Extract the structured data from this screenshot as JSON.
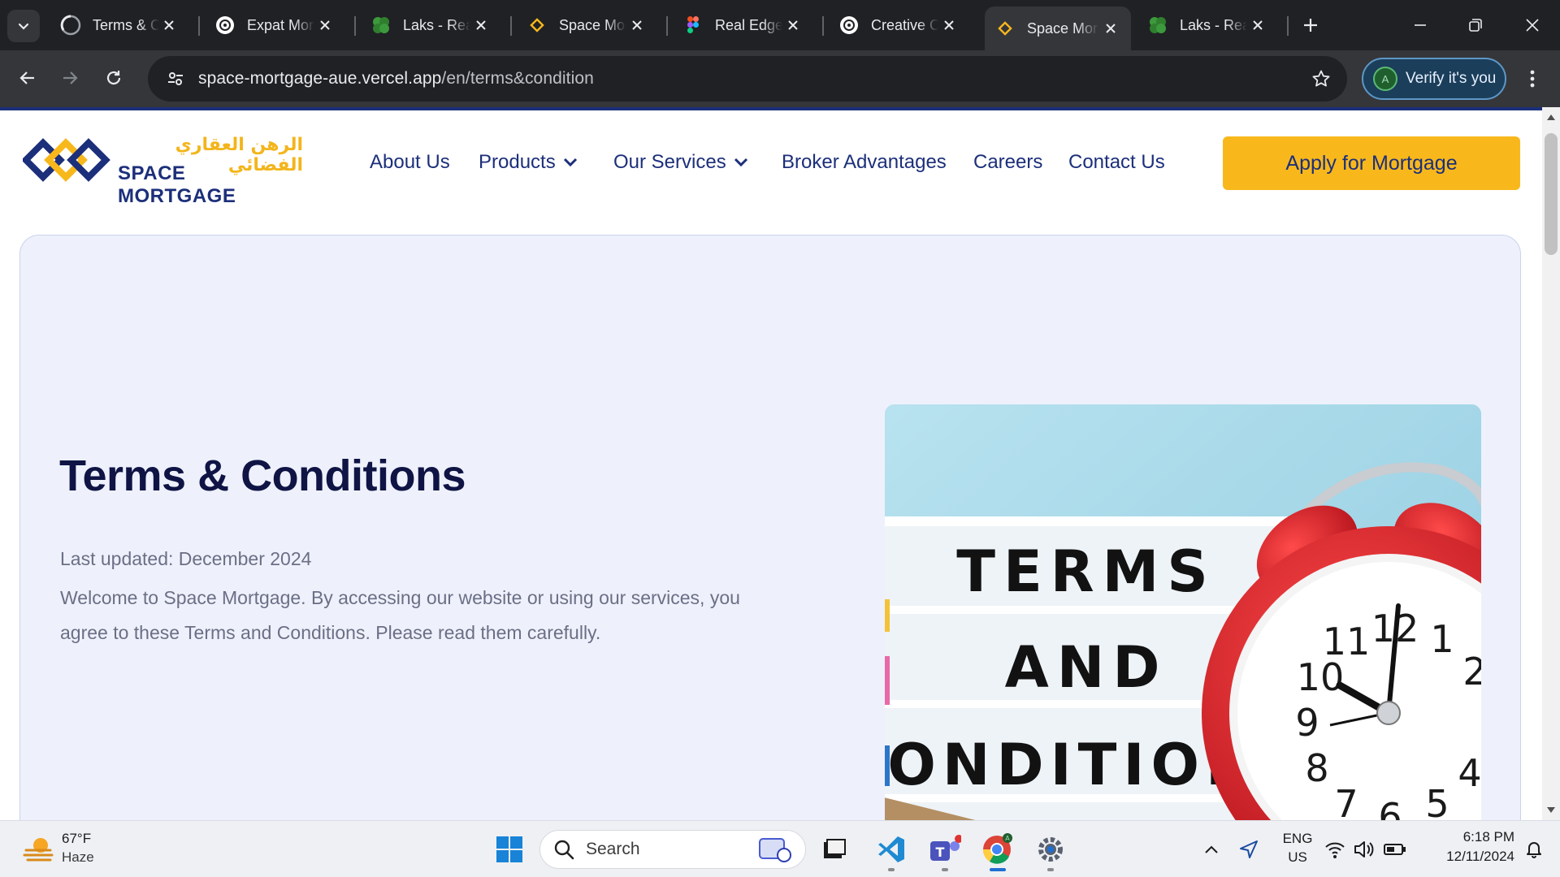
{
  "browser": {
    "tabs": [
      {
        "title": "Terms & Conditions",
        "favicon": "circle-loading-icon"
      },
      {
        "title": "Expat Mortgage",
        "favicon": "openai-icon"
      },
      {
        "title": "Laks - Real Estate",
        "favicon": "laks-clover-icon"
      },
      {
        "title": "Space Mortgage",
        "favicon": "space-mortgage-diamond-icon"
      },
      {
        "title": "Real Edge",
        "favicon": "figma-icon"
      },
      {
        "title": "Creative Content",
        "favicon": "openai-icon"
      },
      {
        "title": "Space Mortgage",
        "favicon": "space-mortgage-diamond-icon",
        "active": true
      },
      {
        "title": "Laks - Real Estate",
        "favicon": "laks-clover-icon"
      }
    ],
    "address": {
      "host": "space-mortgage-aue.vercel.app",
      "path": "/en/terms&condition"
    },
    "profile_button": "Verify it's you",
    "profile_initial": "A"
  },
  "site": {
    "logo": {
      "arabic": "الرهن العقاري الفضائي",
      "name": "SPACE MORTGAGE"
    },
    "nav": {
      "about": "About Us",
      "products": "Products",
      "services": "Our Services",
      "broker": "Broker Advantages",
      "careers": "Careers",
      "contact": "Contact Us"
    },
    "cta": "Apply for Mortgage",
    "hero": {
      "title": "Terms & Conditions",
      "updated": "Last updated: December 2024",
      "body": "Welcome to Space Mortgage. By accessing our website or using our services, you agree to these Terms and Conditions. Please read them carefully.",
      "image_lines": [
        "TERMS",
        "AND",
        "CONDITIONS"
      ]
    }
  },
  "taskbar": {
    "weather": {
      "temp": "67°F",
      "condition": "Haze"
    },
    "search_placeholder": "Search",
    "lang_top": "ENG",
    "lang_bottom": "US",
    "time": "6:18 PM",
    "date": "12/11/2024",
    "teams_badge": "",
    "chrome_profile": "A"
  },
  "colors": {
    "brand_navy": "#1c2f7a",
    "brand_yellow": "#f8b81c",
    "hero_bg": "#eef1fb",
    "clock_red": "#d81f26"
  }
}
